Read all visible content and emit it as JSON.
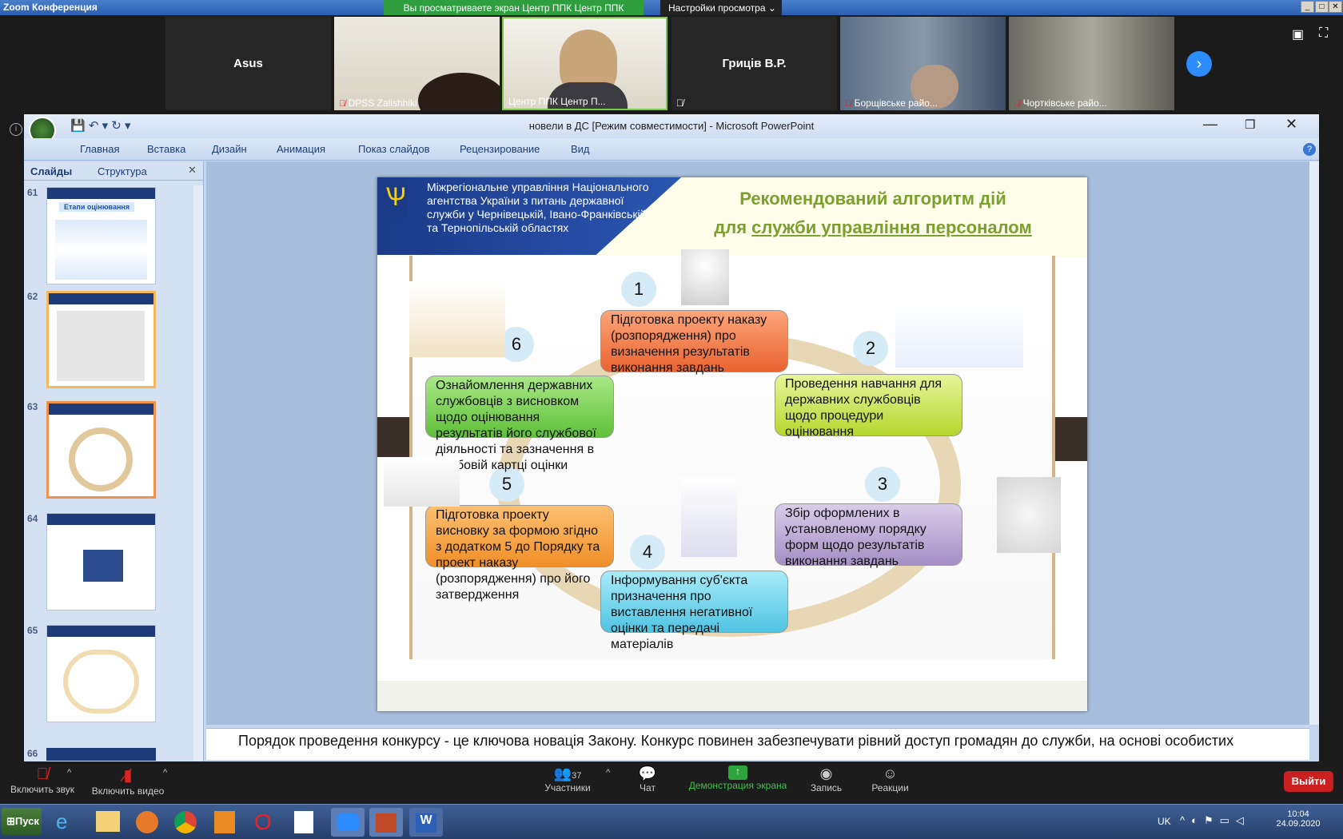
{
  "zoom": {
    "window_title": "Zoom Конференция",
    "share_banner": "Вы просматриваете экран Центр ППК Центр ППК",
    "view_settings": "Настройки просмотра",
    "participants": [
      {
        "name": "Asus",
        "label": ""
      },
      {
        "name": "",
        "label": "DPSS Zalishhiki"
      },
      {
        "name": "",
        "label": "Центр ППК Центр П..."
      },
      {
        "name": "Гриців В.Р.",
        "label": ""
      },
      {
        "name": "",
        "label": "Борщівське райо..."
      },
      {
        "name": "",
        "label": "Чортківське райо..."
      }
    ],
    "toolbar": {
      "mute": "Включить звук",
      "video": "Включить видео",
      "participants": "Участники",
      "participants_count": "37",
      "chat": "Чат",
      "share": "Демонстрация экрана",
      "record": "Запись",
      "reactions": "Реакции",
      "leave": "Выйти"
    }
  },
  "ppt": {
    "title": "новели в ДС [Режим совместимости] - Microsoft PowerPoint",
    "tabs": [
      "Главная",
      "Вставка",
      "Дизайн",
      "Анимация",
      "Показ слайдов",
      "Рецензирование",
      "Вид"
    ],
    "panel_tabs": [
      "Слайды",
      "Структура"
    ],
    "thumbs": [
      "61",
      "62",
      "63",
      "64",
      "65",
      "66"
    ],
    "thumb61_title": "Етапи оцінювання",
    "notes": "Порядок проведення конкурсу - це ключова новація Закону. Конкурс повинен забезпечувати рівний доступ громадян до служби, на основі особистих"
  },
  "slide": {
    "header_org": "Міжрегіональне управління Національного агентства України з питань державної служби у Чернівецькій, Івано-Франківській та Тернопільській областях",
    "title_line1": "Рекомендований алгоритм дій",
    "title_line2_prefix": "для ",
    "title_line2_underlined": "служби управління персоналом",
    "steps": [
      {
        "n": "1",
        "text": "Підготовка проекту наказу (розпорядження) про визначення результатів виконання завдань"
      },
      {
        "n": "2",
        "text": "Проведення навчання для державних службовців щодо процедури оцінювання"
      },
      {
        "n": "3",
        "text": "Збір оформлених в установленому порядку форм щодо результатів виконання завдань"
      },
      {
        "n": "4",
        "text": "Інформування суб'єкта призначення про виставлення негативної оцінки та передачі матеріалів"
      },
      {
        "n": "5",
        "text": "Підготовка проекту висновку за формою згідно з додатком 5 до Порядку та  проект наказу (розпорядження) про його затвердження"
      },
      {
        "n": "6",
        "text": "Ознайомлення державних службовців з висновком щодо оцінювання результатів його службової діяльності та зазначення в особовій картці оцінки"
      }
    ],
    "colors": {
      "s1": "#f07a3e",
      "s2": "#c8e04a",
      "s3": "#b9a7cf",
      "s4": "#6fd3ea",
      "s5": "#f5a340",
      "s6": "#7fd05a"
    }
  },
  "taskbar": {
    "start": "Пуск",
    "lang": "UK",
    "time": "10:04",
    "date": "24.09.2020"
  }
}
